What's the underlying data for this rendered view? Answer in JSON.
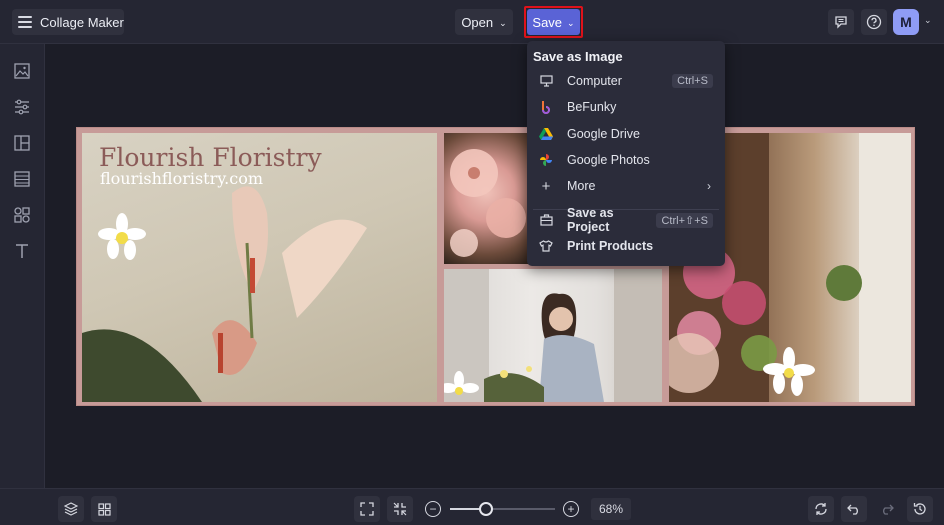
{
  "header": {
    "app_title": "Collage Maker",
    "open_label": "Open",
    "save_label": "Save",
    "avatar_initial": "M"
  },
  "save_menu": {
    "title": "Save as Image",
    "items": [
      {
        "label": "Computer",
        "shortcut": "Ctrl+S",
        "icon": "monitor-icon"
      },
      {
        "label": "BeFunky",
        "icon": "befunky-icon"
      },
      {
        "label": "Google Drive",
        "icon": "google-drive-icon"
      },
      {
        "label": "Google Photos",
        "icon": "google-photos-icon"
      },
      {
        "label": "More",
        "icon": "plus-icon"
      },
      {
        "label": "Save as Project",
        "shortcut": "Ctrl+⇧+S",
        "icon": "briefcase-icon"
      },
      {
        "label": "Print Products",
        "icon": "tshirt-icon"
      }
    ]
  },
  "collage": {
    "title": "Flourish Floristry",
    "url": "flourishfloristry.com"
  },
  "bottom": {
    "zoom_value": "68%",
    "zoom_fraction": 0.34
  },
  "colors": {
    "accent": "#5a63d6",
    "highlight": "#e0121a",
    "avatar": "#8f9cf5"
  }
}
